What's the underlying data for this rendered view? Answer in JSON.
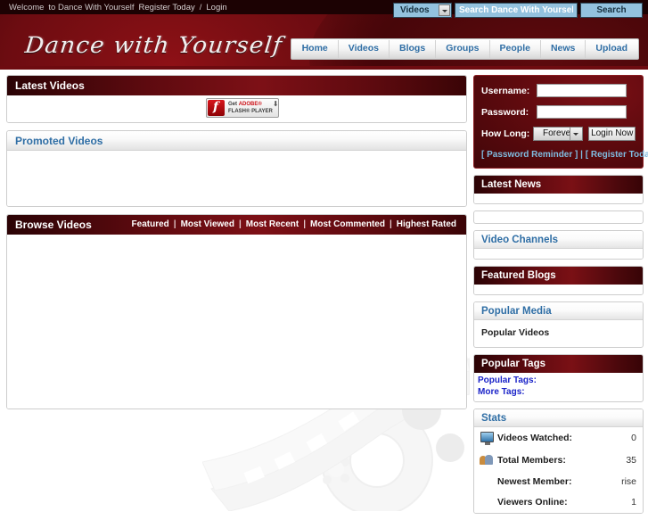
{
  "topbar": {
    "welcome": "Welcome",
    "site_name": "to Dance With Yourself",
    "register": "Register Today",
    "separator": "/",
    "login": "Login"
  },
  "header": {
    "logo_text": "Dance with Yourself"
  },
  "search": {
    "category_selected": "Videos",
    "input_value": "Search Dance With Yourself",
    "placeholder": "Search Dance With Yourself",
    "button_label": "Search"
  },
  "nav": {
    "items": [
      {
        "label": "Home"
      },
      {
        "label": "Videos"
      },
      {
        "label": "Blogs"
      },
      {
        "label": "Groups"
      },
      {
        "label": "People"
      },
      {
        "label": "News"
      },
      {
        "label": "Upload"
      }
    ]
  },
  "main": {
    "latest_videos": {
      "title": "Latest Videos",
      "flash_badge": {
        "get": "Get",
        "adobe": "ADOBE®",
        "flash_player": "FLASH® PLAYER",
        "download_glyph": "⬇"
      }
    },
    "promoted_videos": {
      "title": "Promoted Videos"
    },
    "browse_videos": {
      "title": "Browse Videos",
      "tabs": [
        {
          "label": "Featured"
        },
        {
          "label": "Most Viewed"
        },
        {
          "label": "Most Recent"
        },
        {
          "label": "Most Commented"
        },
        {
          "label": "Highest Rated"
        }
      ],
      "tab_separator": "|"
    }
  },
  "sidebar": {
    "login": {
      "username_label": "Username:",
      "username_value": "",
      "password_label": "Password:",
      "password_value": "",
      "howlong_label": "How Long:",
      "howlong_selected": "Forever",
      "login_button": "Login Now",
      "password_reminder": "[ Password Reminder ]",
      "links_separator": "|",
      "register_today": "[ Register Today ]"
    },
    "latest_news": {
      "title": "Latest News"
    },
    "video_channels": {
      "title": "Video Channels"
    },
    "featured_blogs": {
      "title": "Featured Blogs"
    },
    "popular_media": {
      "title": "Popular Media",
      "item": "Popular Videos"
    },
    "popular_tags": {
      "title": "Popular Tags",
      "lines": [
        {
          "label": "Popular Tags:"
        },
        {
          "label": "More Tags:"
        }
      ]
    },
    "stats": {
      "title": "Stats",
      "rows": [
        {
          "icon": "monitor-icon",
          "label": "Videos Watched:",
          "value": "0"
        },
        {
          "icon": "people-icon",
          "label": "Total Members:",
          "value": "35"
        },
        {
          "icon": "",
          "label": "Newest Member:",
          "value": "rise"
        },
        {
          "icon": "",
          "label": "Viewers Online:",
          "value": "1"
        }
      ]
    }
  },
  "colors": {
    "header_dark_red": "#3a0406",
    "panel_header_red": "#7d1016",
    "link_blue": "#2f6ea5",
    "search_blue": "#93c2de",
    "tag_blue": "#1a23c8",
    "login_link_blue": "#7fbce0"
  }
}
